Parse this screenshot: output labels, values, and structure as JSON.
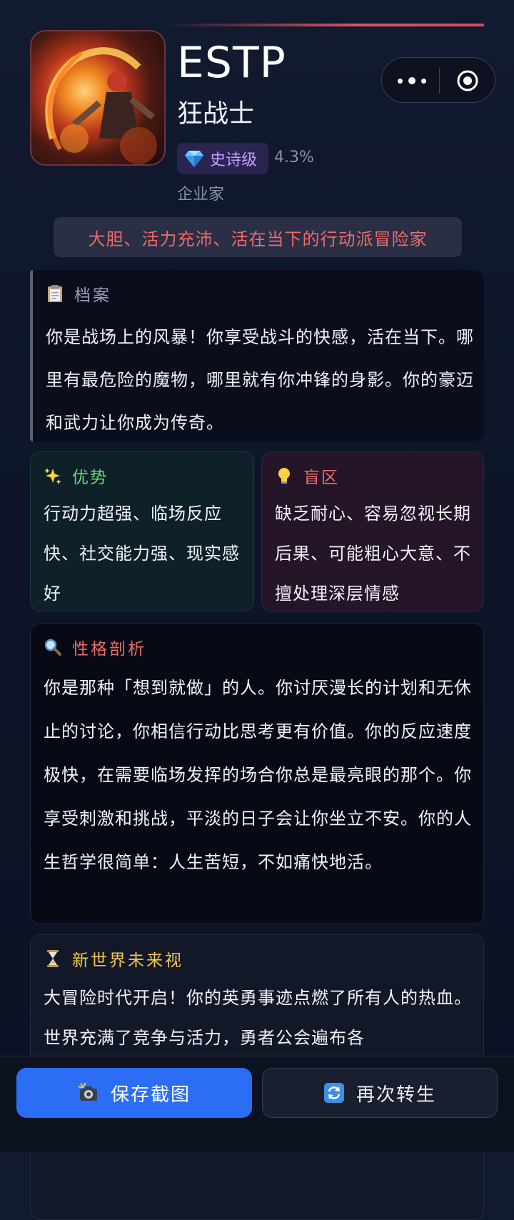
{
  "profile": {
    "type_code": "ESTP",
    "class_name": "狂战士",
    "rarity_label": "史诗级",
    "rarity_percent": "4.3%",
    "role": "企业家",
    "tagline": "大胆、活力充沛、活在当下的行动派冒险家"
  },
  "icons": {
    "rarity": "diamond-gem-icon",
    "menu": "more-dots-icon",
    "close": "target-circle-icon",
    "archive": "clipboard-icon",
    "strengths": "sparkles-icon",
    "blindspots": "lightbulb-icon",
    "analysis": "magnifier-icon",
    "future": "hourglass-icon",
    "save": "camera-flash-icon",
    "again": "refresh-arrows-icon"
  },
  "archive": {
    "title": "档案",
    "text": "你是战场上的风暴！你享受战斗的快感，活在当下。哪里有最危险的魔物，哪里就有你冲锋的身影。你的豪迈和武力让你成为传奇。"
  },
  "strengths": {
    "title": "优势",
    "text": "行动力超强、临场反应快、社交能力强、现实感好"
  },
  "blindspots": {
    "title": "盲区",
    "text": "缺乏耐心、容易忽视长期后果、可能粗心大意、不擅处理深层情感"
  },
  "analysis": {
    "title": "性格剖析",
    "text": "你是那种「想到就做」的人。你讨厌漫长的计划和无休止的讨论，你相信行动比思考更有价值。你的反应速度极快，在需要临场发挥的场合你总是最亮眼的那个。你享受刺激和挑战，平淡的日子会让你坐立不安。你的人生哲学很简单：人生苦短，不如痛快地活。"
  },
  "future": {
    "title": "新世界未来视",
    "text": "大冒险时代开启！你的英勇事迹点燃了所有人的热血。世界充满了竞争与活力，勇者公会遍布各"
  },
  "actions": {
    "save_label": "保存截图",
    "again_label": "再次转生"
  },
  "colors": {
    "accent_blue": "#2b6ef5",
    "accent_red": "#ef6a6a",
    "rarity_purple": "#c59cff",
    "strength_green": "#5fe07a",
    "future_gold": "#f1c74a"
  }
}
